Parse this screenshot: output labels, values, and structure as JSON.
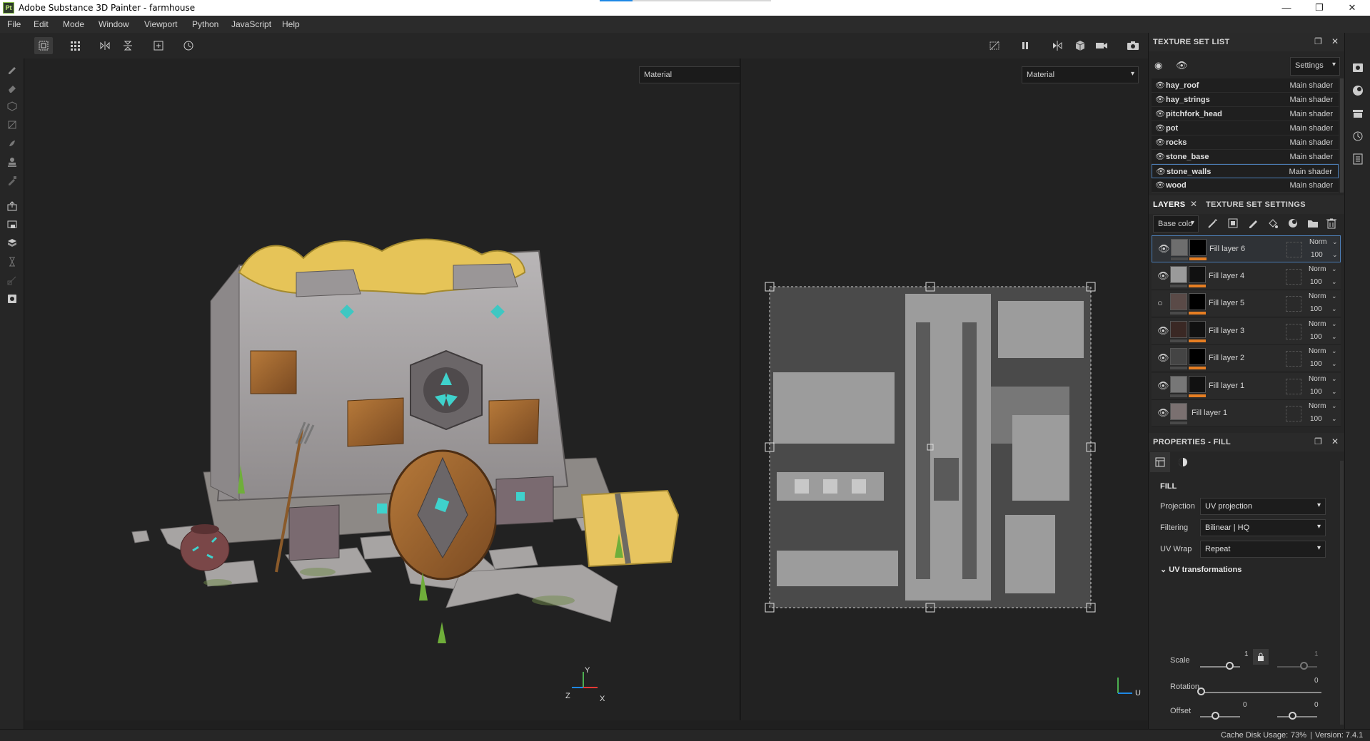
{
  "window": {
    "title": "Adobe Substance 3D Painter - farmhouse",
    "logo": "Pt",
    "controls": [
      "—",
      "❐",
      "✕"
    ]
  },
  "menu": [
    "File",
    "Edit",
    "Mode",
    "Window",
    "Viewport",
    "Python",
    "JavaScript",
    "Help"
  ],
  "viewport_left": {
    "channel": "Material"
  },
  "viewport_right": {
    "channel": "Material"
  },
  "gizmo_left": {
    "x": "X",
    "y": "Y",
    "z": "Z"
  },
  "gizmo_right": {
    "y": "↑",
    "u": "U"
  },
  "texture_set_list": {
    "title": "TEXTURE SET LIST",
    "settings_label": "Settings",
    "items": [
      {
        "name": "hay_roof",
        "shader": "Main shader"
      },
      {
        "name": "hay_strings",
        "shader": "Main shader"
      },
      {
        "name": "pitchfork_head",
        "shader": "Main shader"
      },
      {
        "name": "pot",
        "shader": "Main shader"
      },
      {
        "name": "rocks",
        "shader": "Main shader"
      },
      {
        "name": "stone_base",
        "shader": "Main shader"
      },
      {
        "name": "stone_walls",
        "shader": "Main shader",
        "selected": true
      },
      {
        "name": "wood",
        "shader": "Main shader"
      }
    ]
  },
  "layers_panel": {
    "tab_layers": "LAYERS",
    "tab_tss": "TEXTURE SET SETTINGS",
    "channel": "Base colo",
    "items": [
      {
        "name": "Fill layer 6",
        "blend": "Norm",
        "opacity": "100",
        "visible": true,
        "selected": true,
        "color": "#6e6e6e"
      },
      {
        "name": "Fill layer 4",
        "blend": "Norm",
        "opacity": "100",
        "visible": true,
        "color": "#9a9a9a"
      },
      {
        "name": "Fill layer 5",
        "blend": "Norm",
        "opacity": "100",
        "visible": false,
        "color": "#5a4a47"
      },
      {
        "name": "Fill layer 3",
        "blend": "Norm",
        "opacity": "100",
        "visible": true,
        "color": "#3a2824"
      },
      {
        "name": "Fill layer 2",
        "blend": "Norm",
        "opacity": "100",
        "visible": true,
        "color": "#444444"
      },
      {
        "name": "Fill layer 1",
        "blend": "Norm",
        "opacity": "100",
        "visible": true,
        "color": "#777777"
      },
      {
        "name": "Fill layer 1",
        "blend": "Norm",
        "opacity": "100",
        "visible": true,
        "color": "#7a7070"
      }
    ]
  },
  "properties": {
    "title": "PROPERTIES - FILL",
    "section": "FILL",
    "projection_label": "Projection",
    "projection_value": "UV projection",
    "filtering_label": "Filtering",
    "filtering_value": "Bilinear | HQ",
    "uvwrap_label": "UV Wrap",
    "uvwrap_value": "Repeat",
    "uv_transformations": "UV transformations",
    "scale_label": "Scale",
    "scale_value_1": "1",
    "scale_value_2": "1",
    "rotation_label": "Rotation",
    "rotation_value": "0",
    "offset_label": "Offset",
    "offset_value_1": "0",
    "offset_value_2": "0"
  },
  "status": {
    "cache": "Cache Disk Usage:",
    "usage": "73%",
    "separator": "|",
    "version": "Version: 7.4.1"
  }
}
